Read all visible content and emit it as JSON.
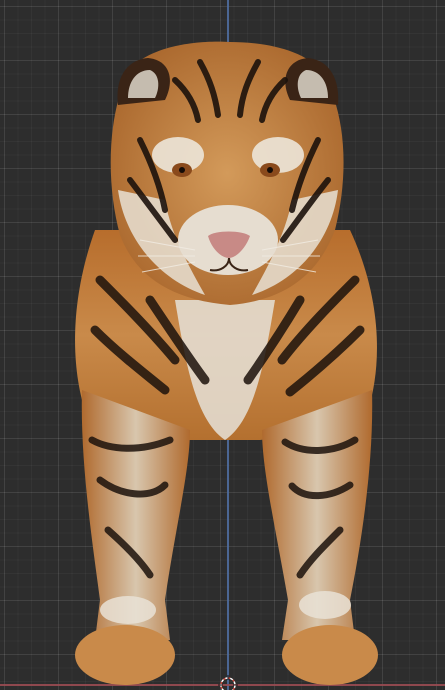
{
  "viewport": {
    "background": "#2d2d2d",
    "grid_color": "#3c3c3c",
    "axis_y_color": "#4f6d9e",
    "axis_x_color": "#9a4b52"
  },
  "subject": {
    "icon": "tiger-model",
    "fur_color": "#c27a36",
    "stripe_color": "#1c120c",
    "white_fur_color": "#e9e2d6"
  },
  "origin": {
    "icon": "3d-cursor-icon"
  }
}
